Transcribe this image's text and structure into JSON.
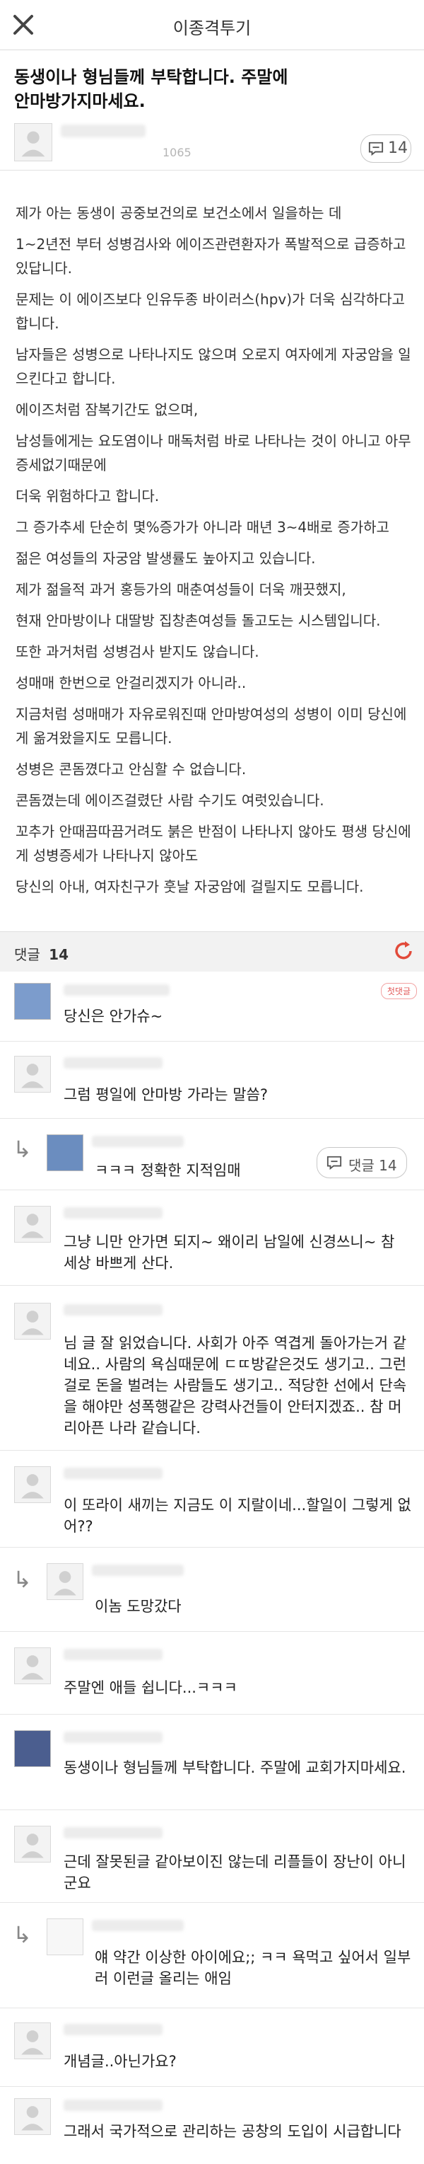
{
  "topbar": {
    "title": "이종격투기"
  },
  "post": {
    "title_lines": [
      "동생이나 형님들께 부탁합니다. 주말에",
      "안마방가지마세요."
    ],
    "views": "1065",
    "comment_count": "14",
    "body": [
      "제가 아는 동생이 공중보건의로 보건소에서 일을하는 데",
      "1~2년전 부터 성병검사와 에이즈관련환자가 폭발적으로 급증하고 있답니다.",
      "문제는 이 에이즈보다 인유두종 바이러스(hpv)가 더욱 심각하다고 합니다.",
      "남자들은 성병으로 나타나지도 않으며 오로지 여자에게 자궁암을 일으킨다고 합니다.",
      "에이즈처럼 잠복기간도 없으며,",
      "남성들에게는 요도염이나 매독처럼 바로 나타나는 것이 아니고 아무증세없기때문에",
      "더욱 위험하다고 합니다.",
      "그 증가추세 단순히 몇%증가가 아니라 매년 3~4배로 증가하고",
      "젊은 여성들의 자궁암 발생률도 높아지고 있습니다.",
      "제가 젊을적 과거 홍등가의 매춘여성들이 더욱 깨끗했지,",
      "현재 안마방이나 대딸방 집창촌여성들 돌고도는 시스템입니다.",
      "또한 과거처럼 성병검사 받지도 않습니다.",
      "성매매 한번으로 안걸리겠지가 아니라..",
      "지금처럼 성매매가 자유로워진때 안마방여성의 성병이 이미 당신에게 옮겨왔을지도 모릅니다.",
      "성병은 콘돔꼈다고 안심할 수 없습니다.",
      "콘돔꼈는데 에이즈걸렸단 사람 수기도 여럿있습니다.",
      "꼬추가 안때끔따끔거려도 붉은 반점이 나타나지 않아도 평생 당신에게 성병증세가 나타나지 않아도",
      "당신의 아내, 여자친구가 훗날 자궁암에 걸릴지도 모릅니다."
    ]
  },
  "comments_bar": {
    "label": "댓글",
    "count": "14"
  },
  "comments": [
    {
      "text": "당신은 안가슈~",
      "badge": "첫댓글"
    },
    {
      "text": "그럼 평일에 안마방 가라는 말씀?"
    },
    {
      "text": "ㅋㅋㅋ 정확한 지적임매",
      "reply_badge": "댓글 14"
    },
    {
      "text": "그냥 니만 안가면 되지~ 왜이리 남일에 신경쓰니~ 참 세상 바쁘게 산다."
    },
    {
      "text": "님 글 잘 읽었습니다. 사회가 아주 역겹게 돌아가는거 같네요.. 사람의 욕심때문에 ㄷㄸ방같은것도 생기고.. 그런걸로 돈을 벌려는 사람들도 생기고.. 적당한 선에서 단속을 해야만 성폭행같은 강력사건들이 안터지겠죠.. 참 머리아픈 나라 같습니다."
    },
    {
      "text": "이 또라이 새끼는 지금도 이 지랄이네...할일이 그렇게 없어??"
    },
    {
      "text": "이놈 도망갔다"
    },
    {
      "text": "주말엔 애들 쉽니다...ㅋㅋㅋ"
    },
    {
      "text": "동생이나 형님들께 부탁합니다. 주말에 교회가지마세요."
    },
    {
      "text": "근데 잘못된글 같아보이진 않는데 리플들이 장난이 아니군요"
    },
    {
      "text": "얘 약간 이상한 아이에요;; ㅋㅋ 욕먹고 싶어서 일부러 이런글 올리는 애임"
    },
    {
      "text": "개념글..아닌가요?"
    },
    {
      "text": "그래서 국가적으로 관리하는 공창의 도입이 시급합니다"
    }
  ]
}
